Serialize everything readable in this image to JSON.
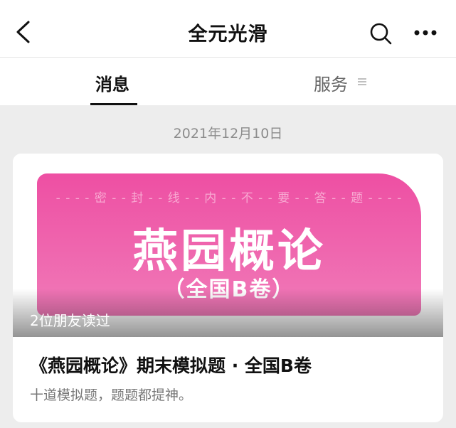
{
  "header": {
    "title": "全元光滑",
    "icons": [
      "chevron-left-icon",
      "search-icon",
      "more-icon"
    ]
  },
  "tabs": [
    {
      "label": "消息",
      "active": true
    },
    {
      "label": "服务",
      "icon": "menu-icon"
    }
  ],
  "date": "2021年12月10日",
  "article": {
    "seal_text": "- - - - 密 - - 封 - - 线 - - 内 - - 不 - - 要 - - 答 - - 题 - - - -",
    "cover_title": "燕园概论",
    "cover_subtitle": "（全国B卷）",
    "readers": "2位朋友读过",
    "title": "《燕园概论》期末模拟题 · 全国B卷",
    "description": "十道模拟题，题题都提神。",
    "accent_color": "#ee4fa3"
  }
}
